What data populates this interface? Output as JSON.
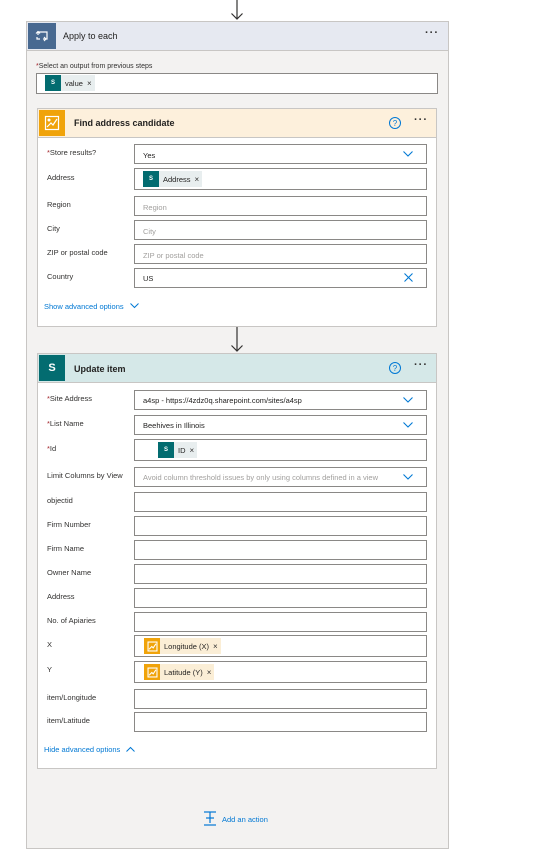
{
  "apply_each": {
    "title": "Apply to each",
    "select_label": "Select an output from previous steps",
    "token": "value"
  },
  "find_address": {
    "title": "Find address candidate",
    "fields": {
      "store_label": "Store results?",
      "store_value": "Yes",
      "address_label": "Address",
      "address_token": "Address",
      "region_label": "Region",
      "region_ph": "Region",
      "city_label": "City",
      "city_ph": "City",
      "zip_label": "ZIP or postal code",
      "zip_ph": "ZIP or postal code",
      "country_label": "Country",
      "country_value": "US"
    },
    "advanced_link": "Show advanced options"
  },
  "update_item": {
    "title": "Update item",
    "fields": {
      "site_label": "Site Address",
      "site_value": "a4sp - https://4zdz0q.sharepoint.com/sites/a4sp",
      "list_label": "List Name",
      "list_value": "Beehives in Illinois",
      "id_label": "Id",
      "id_token": "ID",
      "limit_label": "Limit Columns by View",
      "limit_ph": "Avoid column threshold issues by only using columns defined in a view",
      "objectid_label": "objectid",
      "firm_number_label": "Firm Number",
      "firm_name_label": "Firm Name",
      "owner_label": "Owner Name",
      "address_label": "Address",
      "apiaries_label": "No. of Apiaries",
      "x_label": "X",
      "x_token": "Longitude (X)",
      "y_label": "Y",
      "y_token": "Latitude (Y)",
      "item_long_label": "item/Longitude",
      "item_lat_label": "item/Latitude"
    },
    "advanced_link": "Hide advanced options"
  },
  "add_action": "Add an action",
  "sp_icon_text": "S",
  "icons": [
    "loop-icon",
    "sharepoint-icon",
    "map-icon",
    "help-icon",
    "chevron-down-icon",
    "close-icon",
    "more-icon",
    "arrow-down-icon",
    "add-action-icon",
    "chevron-up-icon"
  ],
  "colors": {
    "loop": "#486991",
    "sharepoint": "#036c70",
    "map": "#f0a30a",
    "link": "#0078d4",
    "required": "#a4262c"
  }
}
